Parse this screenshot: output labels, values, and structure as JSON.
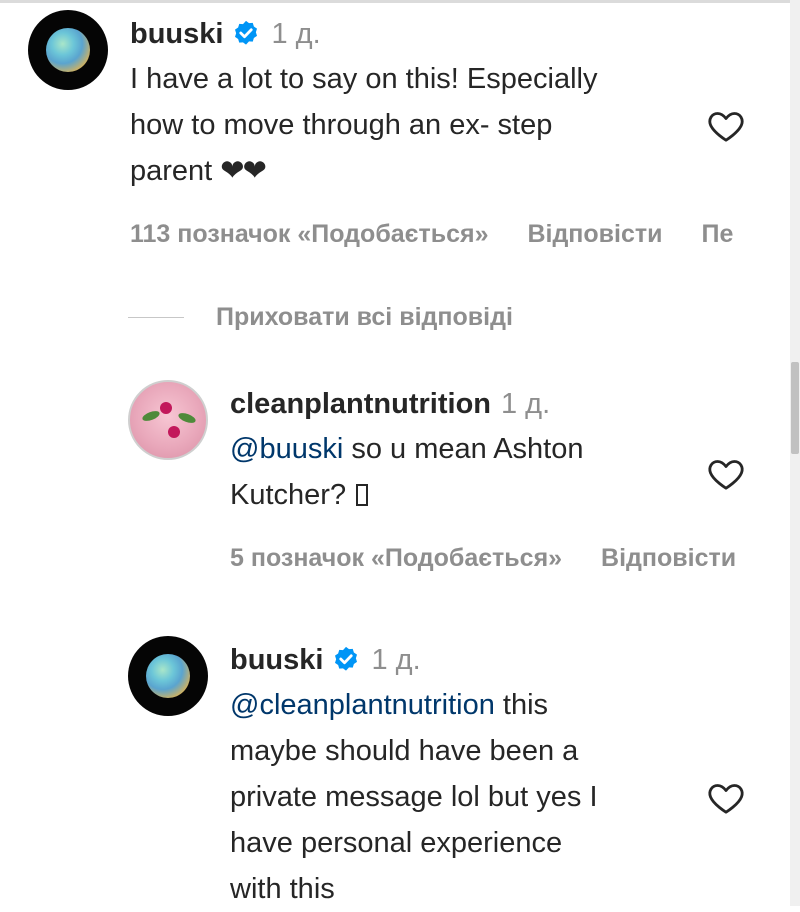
{
  "comments": [
    {
      "username": "buuski",
      "verified": true,
      "time": "1 д.",
      "text_lines": [
        "I have a lot to say on this! Especially",
        "how to move through an ex- step"
      ],
      "text_last": "parent",
      "hearts": "❤❤",
      "likes": "113 позначок «Подобається»",
      "reply": "Відповісти",
      "more": "Пе"
    },
    {
      "username": "cleanplantnutrition",
      "time": "1 д.",
      "mention": "@buuski",
      "text_first_rest": "so u mean Ashton",
      "text_second": "Kutcher?",
      "likes": "5 позначок «Подобається»",
      "reply": "Відповісти"
    },
    {
      "username": "buuski",
      "verified": true,
      "time": "1 д.",
      "mention": "@cleanplantnutrition",
      "text_first_rest": "this",
      "text_lines": [
        "maybe should have been a",
        "private message lol but yes I",
        "have personal experience",
        "with this"
      ]
    }
  ],
  "hide_replies_label": "Приховати всі відповіді",
  "icons": {
    "verified": "verified-badge-icon",
    "like": "heart-outline-icon"
  },
  "colors": {
    "text": "#262626",
    "muted": "#8e8e8e",
    "mention": "#00376b",
    "verified": "#0095f6"
  }
}
